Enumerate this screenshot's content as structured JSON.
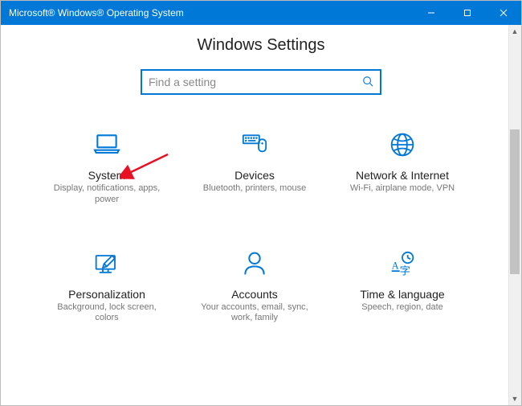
{
  "window": {
    "title": "Microsoft® Windows® Operating System"
  },
  "page": {
    "heading": "Windows Settings"
  },
  "search": {
    "placeholder": "Find a setting"
  },
  "tiles": [
    {
      "key": "system",
      "title": "System",
      "desc": "Display, notifications, apps, power"
    },
    {
      "key": "devices",
      "title": "Devices",
      "desc": "Bluetooth, printers, mouse"
    },
    {
      "key": "network",
      "title": "Network & Internet",
      "desc": "Wi-Fi, airplane mode, VPN"
    },
    {
      "key": "personalization",
      "title": "Personalization",
      "desc": "Background, lock screen, colors"
    },
    {
      "key": "accounts",
      "title": "Accounts",
      "desc": "Your accounts, email, sync, work, family"
    },
    {
      "key": "time",
      "title": "Time & language",
      "desc": "Speech, region, date"
    }
  ],
  "colors": {
    "accent": "#0078d7"
  }
}
